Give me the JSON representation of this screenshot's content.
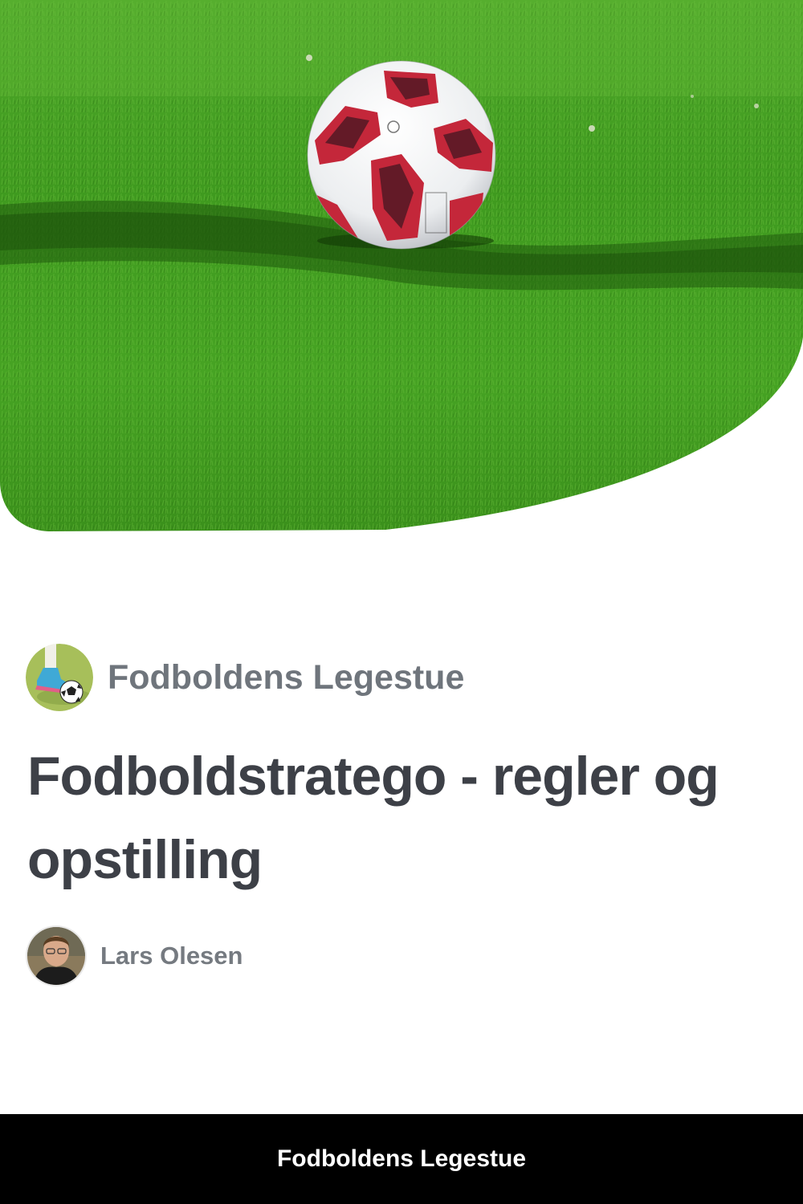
{
  "hero": {
    "image": "football-on-grass-photo"
  },
  "publication": {
    "logo": "football-kick-logo",
    "name": "Fodboldens Legestue"
  },
  "article": {
    "title": "Fodboldstratego - regler og opstilling"
  },
  "author": {
    "avatar": "author-portrait",
    "name": "Lars Olesen"
  },
  "footer": {
    "label": "Fodboldens Legestue"
  },
  "colors": {
    "grass": "#3f9a1f",
    "grass_dark": "#2a6f12",
    "ball_red": "#c4273a",
    "ball_dark": "#3a1520",
    "logo_bg": "#a7bf5a",
    "publication_text": "#6f757c",
    "title_text": "#3d4047",
    "author_text": "#757a80",
    "footer_bg": "#000000",
    "footer_text": "#ffffff"
  }
}
